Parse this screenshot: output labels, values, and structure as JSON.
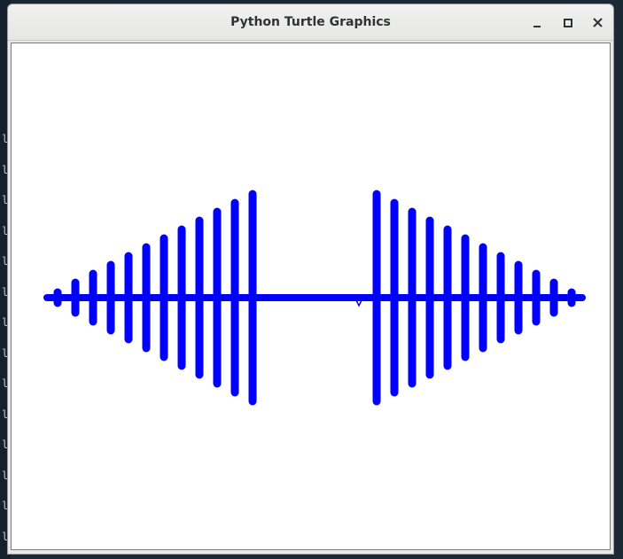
{
  "window": {
    "title": "Python Turtle Graphics"
  },
  "drawing": {
    "pen_color": "#0000ff",
    "background_color": "#ffffff",
    "turtle_shape": "classic-arrow"
  },
  "terminal": {
    "glyph": "l"
  },
  "icons": {
    "minimize": "minimize-icon",
    "maximize": "maximize-icon",
    "close": "close-icon"
  }
}
